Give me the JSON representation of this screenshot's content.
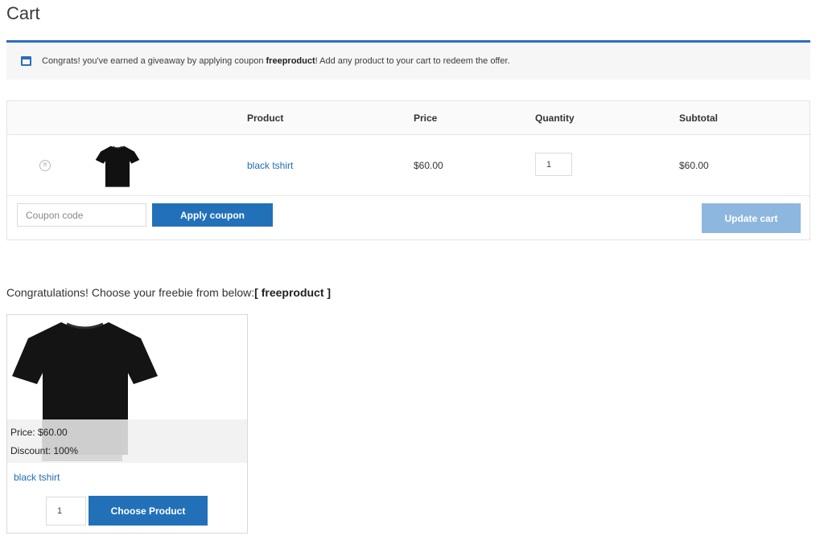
{
  "page": {
    "title": "Cart"
  },
  "notice": {
    "text_before": "Congrats! you've earned a giveaway by applying coupon ",
    "coupon": "freeproduct",
    "text_after": "! Add any product to your cart to redeem the offer.",
    "icon": "window-icon"
  },
  "cart": {
    "headers": {
      "product": "Product",
      "price": "Price",
      "quantity": "Quantity",
      "subtotal": "Subtotal"
    },
    "rows": [
      {
        "remove_icon": "×",
        "name": "black tshirt",
        "price": "$60.00",
        "quantity": "1",
        "subtotal": "$60.00"
      }
    ],
    "coupon_placeholder": "Coupon code",
    "apply_coupon_label": "Apply coupon",
    "update_cart_label": "Update cart"
  },
  "freebie": {
    "heading_prefix": "Congratulations! Choose your freebie from below:",
    "heading_code": "[ freeproduct ]",
    "product": {
      "price_line": "Price: $60.00",
      "discount_line": "Discount: 100%",
      "name": "black tshirt",
      "quantity": "1",
      "choose_label": "Choose Product"
    }
  },
  "colors": {
    "accent": "#2271b8",
    "accent_disabled": "#8db7de",
    "link": "#1f6db5",
    "notice_border": "#2a6fbb"
  }
}
